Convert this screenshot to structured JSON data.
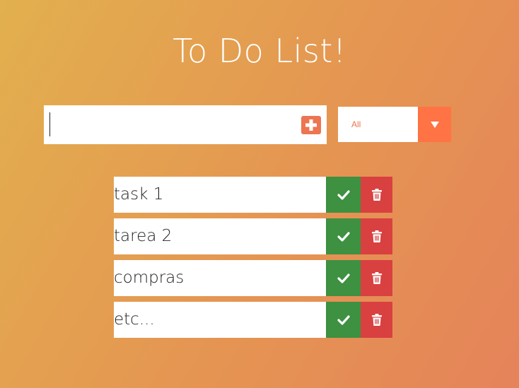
{
  "header": {
    "title": "To Do List!"
  },
  "new_task": {
    "value": "",
    "add_icon": "plus-icon"
  },
  "filter": {
    "selected": "All",
    "arrow_icon": "caret-down-icon"
  },
  "todos": [
    {
      "text": "task 1"
    },
    {
      "text": "tarea 2"
    },
    {
      "text": "compras"
    },
    {
      "text": "etc..."
    }
  ],
  "colors": {
    "accent": "#ec7552",
    "complete": "#3d9141",
    "delete": "#d94040",
    "filter_button": "#ff7345"
  }
}
